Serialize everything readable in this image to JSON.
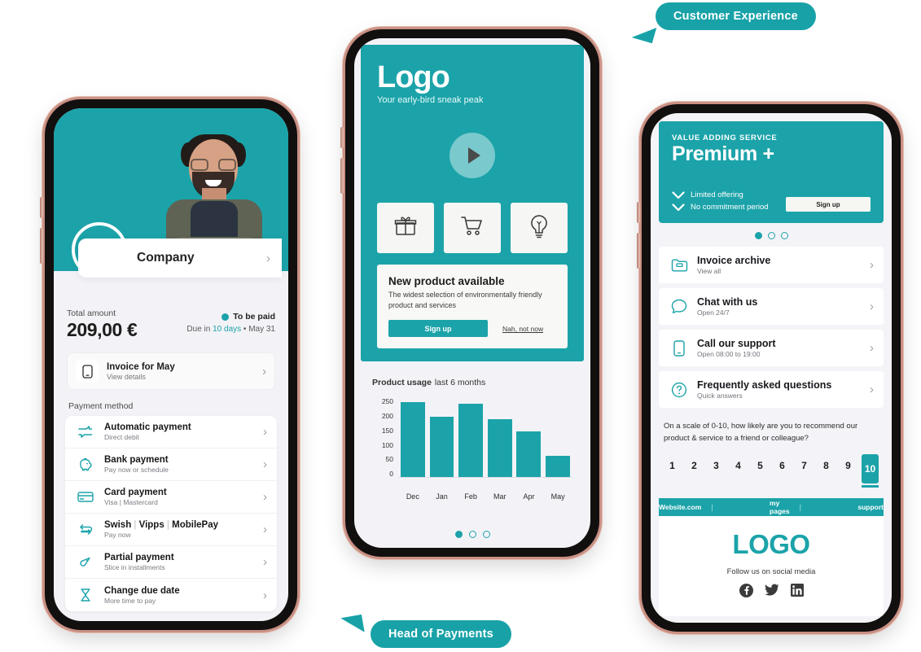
{
  "callouts": {
    "customer_experience": "Customer Experience",
    "head_of_payments": "Head of Payments"
  },
  "phone1": {
    "company_name": "Company",
    "total_label": "Total amount",
    "total_amount": "209,00 €",
    "status": "To be paid",
    "due_prefix": "Due in ",
    "due_highlight": "10 days",
    "due_suffix": " • May 31",
    "invoice": {
      "title": "Invoice for May",
      "sub": "View details",
      "icon": "mobile-invoice-icon"
    },
    "payment_method_label": "Payment method",
    "methods": [
      {
        "title": "Automatic payment",
        "sub": "Direct debit",
        "icon": "auto-payment-icon"
      },
      {
        "title": "Bank payment",
        "sub": "Pay now or schedule",
        "icon": "piggy-bank-icon"
      },
      {
        "title": "Card payment",
        "sub": "Visa  |  Mastercard",
        "icon": "credit-card-icon"
      },
      {
        "title": "Swish | Vipps | MobilePay",
        "sub": "Pay now",
        "icon": "swap-arrows-icon"
      },
      {
        "title": "Partial payment",
        "sub": "Slice in installments",
        "icon": "pie-slice-icon"
      },
      {
        "title": "Change due date",
        "sub": "More time to pay",
        "icon": "hourglass-icon"
      }
    ]
  },
  "phone2": {
    "logo": "Logo",
    "tagline": "Your early-bird sneak peak",
    "play_icon": "play-button-icon",
    "tiles": [
      {
        "icon": "gift-icon"
      },
      {
        "icon": "shopping-cart-icon"
      },
      {
        "icon": "lightbulb-icon"
      }
    ],
    "promo": {
      "title": "New product available",
      "body": "The widest selection of environmentally friendly product and services",
      "primary": "Sign up",
      "secondary": "Nah, not now"
    },
    "chart_heading": "Product usage",
    "chart_sub": "last 6 months",
    "carousel": {
      "count": 3,
      "active": 0
    }
  },
  "phone3": {
    "kicker": "VALUE ADDING SERVICE",
    "title": "Premium +",
    "features": [
      "Limited offering",
      "No commitment period"
    ],
    "signup": "Sign up",
    "carousel": {
      "count": 3,
      "active": 0
    },
    "rows": [
      {
        "title": "Invoice archive",
        "sub": "View all",
        "icon": "folder-icon"
      },
      {
        "title": "Chat with us",
        "sub": "Open 24/7",
        "icon": "chat-bubble-icon"
      },
      {
        "title": "Call our support",
        "sub": "Open 08:00 to 19:00",
        "icon": "phone-icon"
      },
      {
        "title": "Frequently asked questions",
        "sub": "Quick answers",
        "icon": "question-mark-icon"
      }
    ],
    "nps_question": "On a scale of 0-10, how likely are you to recommend our product & service to a friend or colleague?",
    "nps_options": [
      "1",
      "2",
      "3",
      "4",
      "5",
      "6",
      "7",
      "8",
      "9",
      "10"
    ],
    "nps_selected": "10",
    "links": [
      "Website.com",
      "my pages",
      "support"
    ],
    "footer_logo": "LOGO",
    "follow_text": "Follow us on social media",
    "social": [
      "facebook-icon",
      "twitter-icon",
      "linkedin-icon"
    ]
  },
  "colors": {
    "teal": "#1ba3a9",
    "page_bg": "#ffffff",
    "screen_bg": "#f3f3f7"
  },
  "chart_data": {
    "type": "bar",
    "title": "Product usage",
    "subtitle": "last 6 months",
    "categories": [
      "Dec",
      "Jan",
      "Feb",
      "Mar",
      "Apr",
      "May"
    ],
    "values": [
      248,
      202,
      243,
      192,
      152,
      72
    ],
    "yticks": [
      "250",
      "200",
      "150",
      "100",
      "50",
      "0"
    ],
    "ylim": [
      0,
      265
    ],
    "xlabel": "",
    "ylabel": "",
    "grid": false,
    "legend": false,
    "bar_color": "#1ba3a9"
  }
}
